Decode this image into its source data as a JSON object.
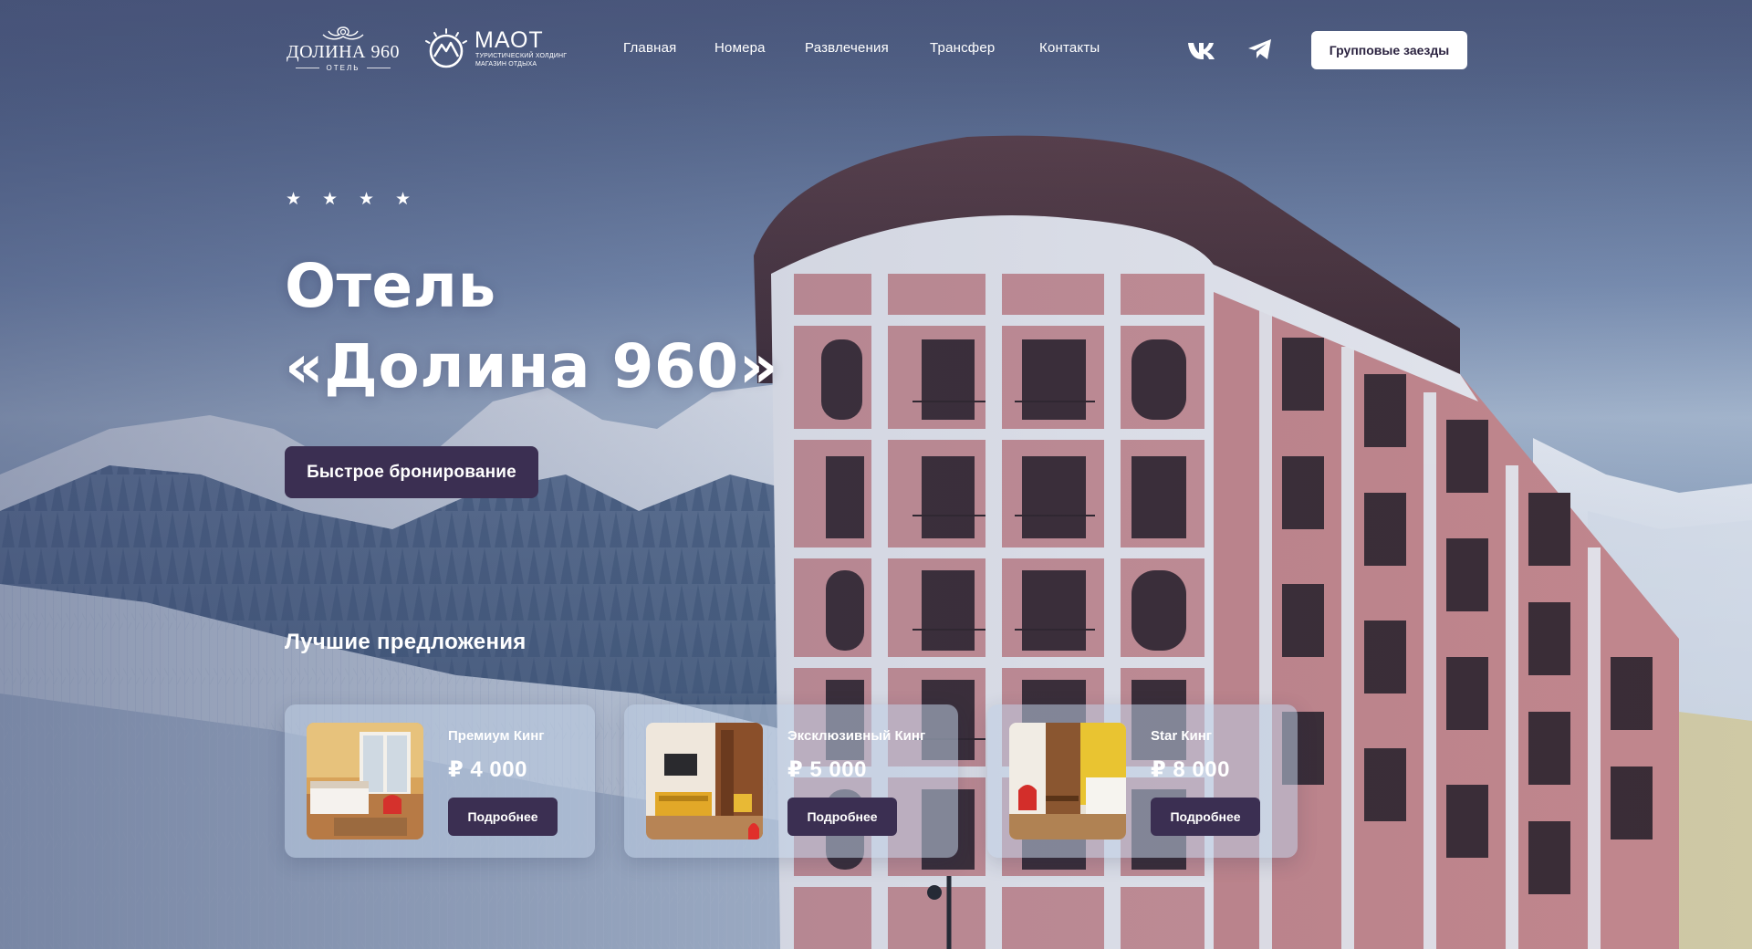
{
  "brand": {
    "hotel_logo_name": "ДОЛИНА 960",
    "hotel_logo_sub": "ОТЕЛЬ",
    "partner_logo_name": "МАОТ",
    "partner_logo_sub1": "ТУРИСТИЧЕСКИЙ ХОЛДИНГ",
    "partner_logo_sub2": "МАГАЗИН ОТДЫХА"
  },
  "nav": {
    "items": [
      {
        "label": "Главная"
      },
      {
        "label": "Номера"
      },
      {
        "label": "Развлечения"
      },
      {
        "label": "Трансфер"
      },
      {
        "label": "Контакты"
      }
    ]
  },
  "social": {
    "icons": [
      "vk-icon",
      "telegram-icon"
    ]
  },
  "header": {
    "group_button_label": "Групповые заезды"
  },
  "hero": {
    "stars": 4,
    "star_glyph": "★",
    "title_line1": "Отель",
    "title_line2": "«Долина 960»",
    "booking_button_label": "Быстрое бронирование"
  },
  "offers": {
    "title": "Лучшие предложения",
    "more_label": "Подробнее",
    "cards": [
      {
        "name": "Премиум Кинг",
        "price": "₽ 4 000"
      },
      {
        "name": "Эксклюзивный Кинг",
        "price": "₽ 5 000"
      },
      {
        "name": "Star Кинг",
        "price": "₽ 8 000"
      }
    ]
  },
  "colors": {
    "accent_dark": "#3b2f52",
    "button_light": "#ffffff",
    "facade_pink": "#c98a8f",
    "facade_trim": "#eef0f6"
  }
}
